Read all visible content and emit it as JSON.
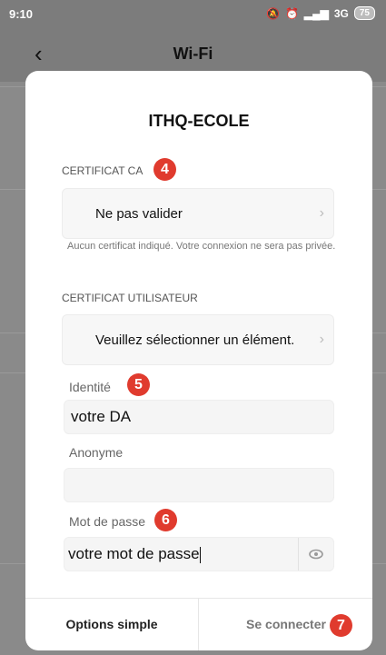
{
  "statusbar": {
    "time": "9:10",
    "network": "3G",
    "battery": "75"
  },
  "header": {
    "back_label": "‹",
    "title": "Wi-Fi"
  },
  "dialog": {
    "title": "ITHQ-ECOLE",
    "ca_certificate": {
      "label": "CERTIFICAT CA",
      "badge": "4",
      "value": "Ne pas valider",
      "note": "Aucun certificat indiqué. Votre connexion ne sera pas privée."
    },
    "user_certificate": {
      "label": "CERTIFICAT UTILISATEUR",
      "value": "Veuillez sélectionner un élément."
    },
    "identity": {
      "label": "Identité",
      "badge": "5",
      "value": "votre DA"
    },
    "anonymous": {
      "label": "Anonyme",
      "value": ""
    },
    "password": {
      "label": "Mot de passe",
      "badge": "6",
      "value": "votre mot de passe"
    },
    "buttons": {
      "simple": "Options simple",
      "connect": "Se connecter",
      "connect_badge": "7"
    }
  },
  "colors": {
    "badge": "#e03b2e",
    "overlay": "#8a8a8a"
  }
}
